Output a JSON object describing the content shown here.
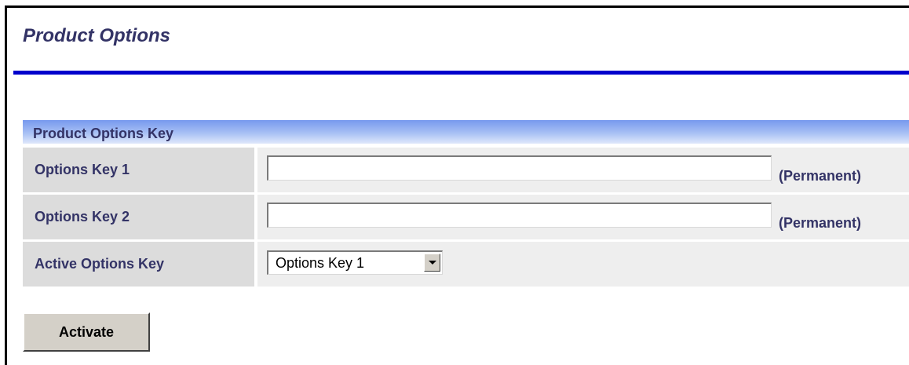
{
  "page": {
    "title": "Product Options"
  },
  "section": {
    "header": "Product Options Key"
  },
  "rows": [
    {
      "label": "Options Key 1",
      "input_value": "",
      "suffix": "(Permanent)"
    },
    {
      "label": "Options Key 2",
      "input_value": "",
      "suffix": "(Permanent)"
    },
    {
      "label": "Active Options Key",
      "selected": "Options Key 1"
    }
  ],
  "actions": {
    "activate_label": "Activate"
  },
  "colors": {
    "title_text": "#333366",
    "title_rule": "#0000cc",
    "header_gradient_top": "#7799ee",
    "label_cell_bg": "#dcdcdc",
    "value_cell_bg": "#eeeeee",
    "button_face": "#d4d0c8"
  },
  "icons": {
    "select_arrow": "chevron-down-icon"
  }
}
